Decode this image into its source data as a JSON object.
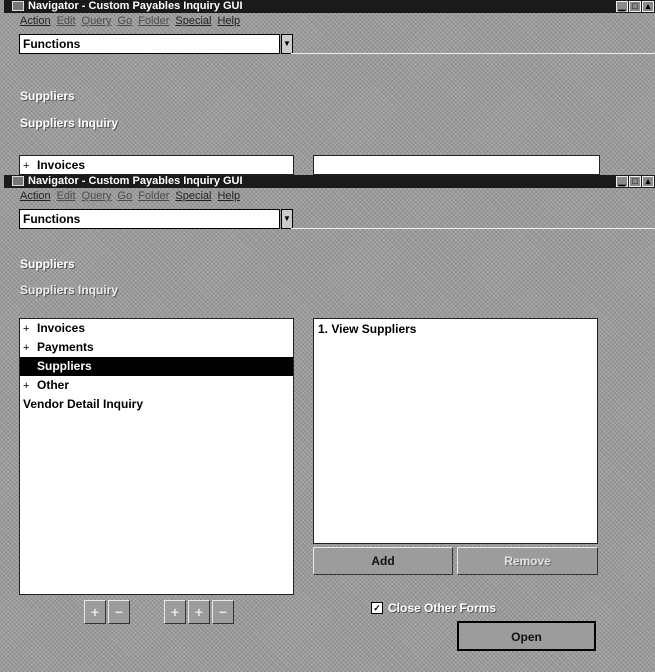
{
  "window_top": {
    "title": "Navigator - Custom Payables Inquiry GUI",
    "menu": [
      "Action",
      "Edit",
      "Query",
      "Go",
      "Folder",
      "Special",
      "Help"
    ],
    "combo_value": "Functions",
    "headings": [
      "Suppliers",
      "Suppliers Inquiry"
    ],
    "tree": [
      {
        "expander": "+",
        "label": "Invoices"
      }
    ]
  },
  "window_main": {
    "title": "Navigator - Custom Payables Inquiry GUI",
    "menu": [
      "Action",
      "Edit",
      "Query",
      "Go",
      "Folder",
      "Special",
      "Help"
    ],
    "combo_value": "Functions",
    "headings": [
      "Suppliers",
      "Suppliers Inquiry"
    ],
    "tree": [
      {
        "expander": "+",
        "label": "Invoices",
        "selected": false
      },
      {
        "expander": "+",
        "label": "Payments",
        "selected": false
      },
      {
        "expander": "",
        "label": "Suppliers",
        "selected": true
      },
      {
        "expander": "+",
        "label": "Other",
        "selected": false
      },
      {
        "expander": "",
        "label": "Vendor Detail Inquiry",
        "selected": false
      }
    ],
    "top_ten": [
      "1. View Suppliers"
    ],
    "buttons": {
      "add": "Add",
      "remove": "Remove",
      "open": "Open",
      "close_other_forms": "Close Other Forms",
      "close_other_forms_checked": true
    },
    "tree_tool_icons": [
      "expand-one-icon",
      "collapse-one-icon",
      "expand-branch-icon",
      "expand-all-icon",
      "collapse-all-icon"
    ]
  }
}
